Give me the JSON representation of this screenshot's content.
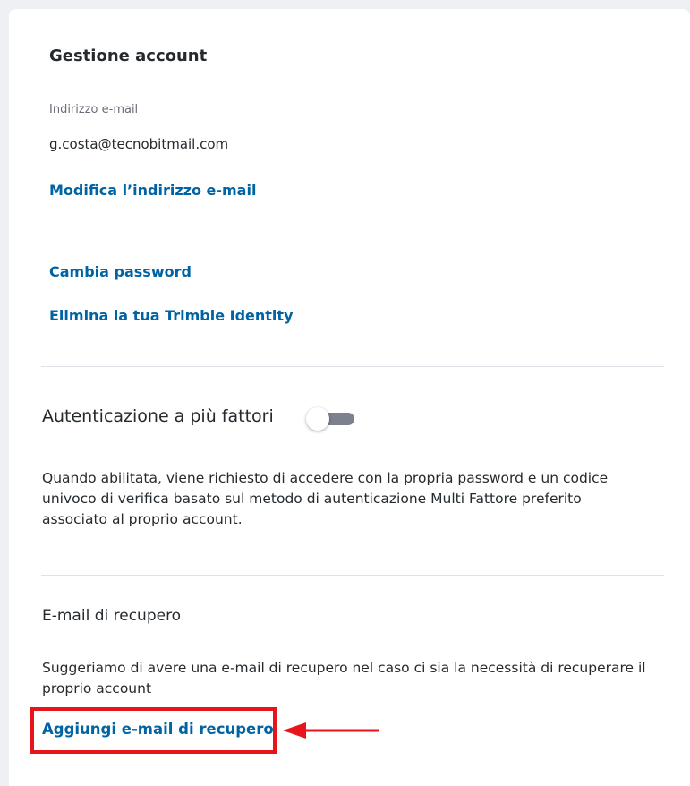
{
  "account": {
    "title": "Gestione account",
    "email_label": "Indirizzo e-mail",
    "email_value": "g.costa@tecnobitmail.com",
    "modify_email_link": "Modifica l’indirizzo e-mail",
    "change_password_link": "Cambia password",
    "delete_identity_link": "Elimina la tua Trimble Identity"
  },
  "mfa": {
    "title": "Autenticazione a più fattori",
    "enabled": false,
    "description": "Quando abilitata, viene richiesto di accedere con la propria password e un codice univoco di verifica basato sul metodo di autenticazione Multi Fattore preferito associato al proprio account."
  },
  "recovery": {
    "title": "E-mail di recupero",
    "description": "Suggeriamo di avere una e-mail di recupero nel caso ci sia la necessità di recuperare il proprio account",
    "add_link": "Aggiungi e-mail di recupero"
  },
  "colors": {
    "link": "#0063a3",
    "text": "#252a2e",
    "annotation": "#e8141b",
    "toggle_off": "#7d808d"
  }
}
